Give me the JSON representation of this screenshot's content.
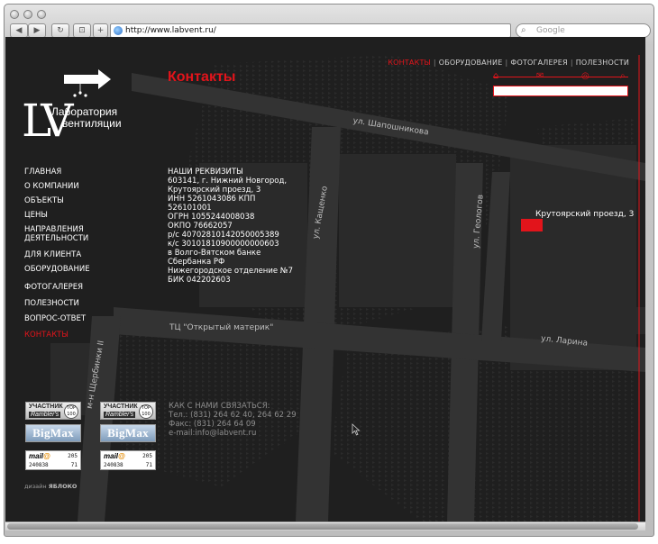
{
  "browser": {
    "url": "http://www.labvent.ru/",
    "search_placeholder": "Google",
    "icons": [
      "back-icon",
      "forward-icon",
      "reload-icon",
      "bookmarks-icon",
      "add-icon",
      "globe-icon",
      "search-icon"
    ],
    "nav_glyphs": {
      "back": "◀",
      "forward": "▶",
      "reload": "↻",
      "bookmarks": "⊡",
      "add": "+"
    }
  },
  "logo": {
    "monogram": "LV",
    "line1": "Лаборатория",
    "line2": "вентиляции"
  },
  "page_title": "Контакты",
  "topnav": [
    {
      "label": "КОНТАКТЫ",
      "active": true
    },
    {
      "label": "ОБОРУДОВАНИЕ",
      "active": false
    },
    {
      "label": "ФОТОГАЛЕРЕЯ",
      "active": false
    },
    {
      "label": "ПОЛЕЗНОСТИ",
      "active": false
    }
  ],
  "site_search": {
    "value": "",
    "tools": [
      "home-icon",
      "mail-icon",
      "sitemap-icon",
      "search-icon"
    ]
  },
  "sidenav": [
    {
      "label": "ГЛАВНАЯ"
    },
    {
      "label": "О КОМПАНИИ"
    },
    {
      "label": "ОБЪЕКТЫ"
    },
    {
      "label": "ЦЕНЫ"
    },
    {
      "label": "НАПРАВЛЕНИЯ"
    },
    {
      "label": "ДЕЯТЕЛЬНОСТИ"
    },
    {
      "label": "ДЛЯ КЛИЕНТА"
    },
    {
      "label": "ОБОРУДОВАНИЕ"
    },
    {
      "label": "ФОТОГАЛЕРЕЯ"
    },
    {
      "label": "ПОЛЕЗНОСТИ"
    },
    {
      "label": "ВОПРОС-ОТВЕТ"
    },
    {
      "label": "КОНТАКТЫ"
    }
  ],
  "requisites": [
    "НАШИ РЕКВИЗИТЫ",
    "603141, г. Нижний Новгород,",
    "Крутоярский проезд, 3",
    "ИНН 5261043086 КПП",
    "526101001",
    "ОГРН 1055244008038",
    "ОКПО 76662057",
    "р/с 40702810142050005389",
    "к/с 30101810900000000603",
    "в Волго-Вятском банке",
    "Сбербанка РФ",
    "Нижегородское отделение №7",
    "БИК 042202603"
  ],
  "contacts": [
    "КАК С НАМИ СВЯЗАТЬСЯ:",
    "Тел.: (831) 264 62 40, 264 62 29",
    "Факс: (831) 264 64 09",
    "e-mail:info@labvent.ru"
  ],
  "map_labels": {
    "shaposhnikova": "ул. Шапошникова",
    "kashchenko": "ул. Кащенко",
    "geologov": "ул. Геологов",
    "krutoyarsky": "Крутоярский проезд, 3",
    "tc": "ТЦ \"Открытый материк\"",
    "larina": "ул. Ларина",
    "shcherbinki": "м-н Щербинки II"
  },
  "counters": {
    "rambler_line1": "УЧАСТНИК",
    "rambler_line2": "Rambler's",
    "rambler_badge": "TOP 100",
    "bigmax": "BigMax",
    "mail_brand": "mail",
    "mail_v1": "205",
    "mail_v2": "240838",
    "mail_v3": "71"
  },
  "design_credit": {
    "prefix": "дизайн",
    "studio": "ЯБЛОКО"
  },
  "colors": {
    "accent": "#e2141b",
    "background": "#1f1f1f",
    "road": "#343434",
    "building": "#2a2a2a"
  }
}
